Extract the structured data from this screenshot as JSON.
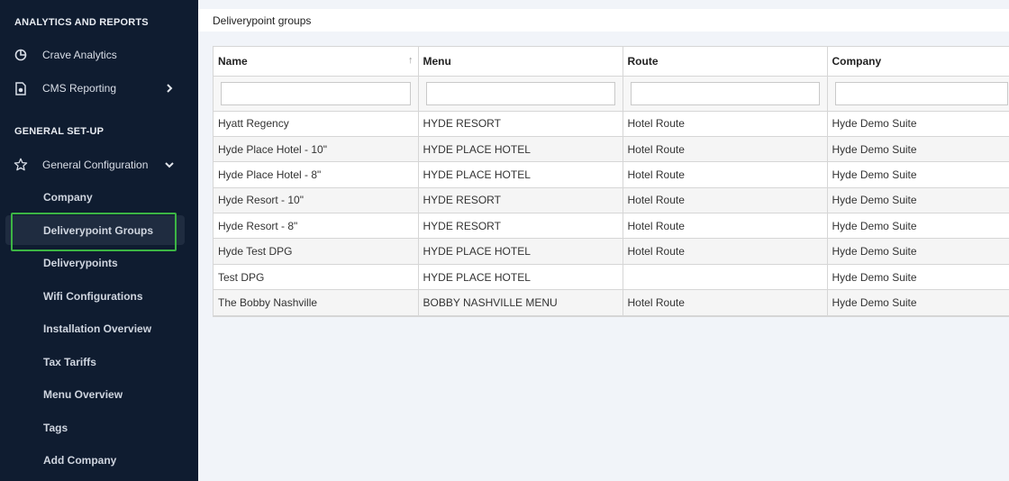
{
  "sidebar": {
    "section_analytics": "ANALYTICS AND REPORTS",
    "crave_analytics": "Crave Analytics",
    "cms_reporting": "CMS Reporting",
    "section_general": "GENERAL SET-UP",
    "general_configuration": "General Configuration",
    "sub_items": [
      "Company",
      "Deliverypoint Groups",
      "Deliverypoints",
      "Wifi Configurations",
      "Installation Overview",
      "Tax Tariffs",
      "Menu Overview",
      "Tags",
      "Add Company"
    ],
    "active_item": "Deliverypoint Groups"
  },
  "page": {
    "title": "Deliverypoint groups"
  },
  "grid": {
    "columns": [
      "Name",
      "Menu",
      "Route",
      "Company"
    ],
    "rows": [
      [
        "Hyatt Regency",
        "HYDE RESORT",
        "Hotel Route",
        "Hyde Demo Suite"
      ],
      [
        "Hyde Place Hotel - 10\"",
        "HYDE PLACE HOTEL",
        "Hotel Route",
        "Hyde Demo Suite"
      ],
      [
        "Hyde Place Hotel - 8\"",
        "HYDE PLACE HOTEL",
        "Hotel Route",
        "Hyde Demo Suite"
      ],
      [
        "Hyde Resort - 10\"",
        "HYDE RESORT",
        "Hotel Route",
        "Hyde Demo Suite"
      ],
      [
        "Hyde Resort - 8\"",
        "HYDE RESORT",
        "Hotel Route",
        "Hyde Demo Suite"
      ],
      [
        "Hyde Test DPG",
        "HYDE PLACE HOTEL",
        "Hotel Route",
        "Hyde Demo Suite"
      ],
      [
        "Test DPG",
        "HYDE PLACE HOTEL",
        "",
        "Hyde Demo Suite"
      ],
      [
        "The Bobby Nashville",
        "BOBBY NASHVILLE MENU",
        "Hotel Route",
        "Hyde Demo Suite"
      ]
    ]
  },
  "colors": {
    "sidebar_bg": "#0f1c30",
    "highlight": "#3cb544"
  }
}
